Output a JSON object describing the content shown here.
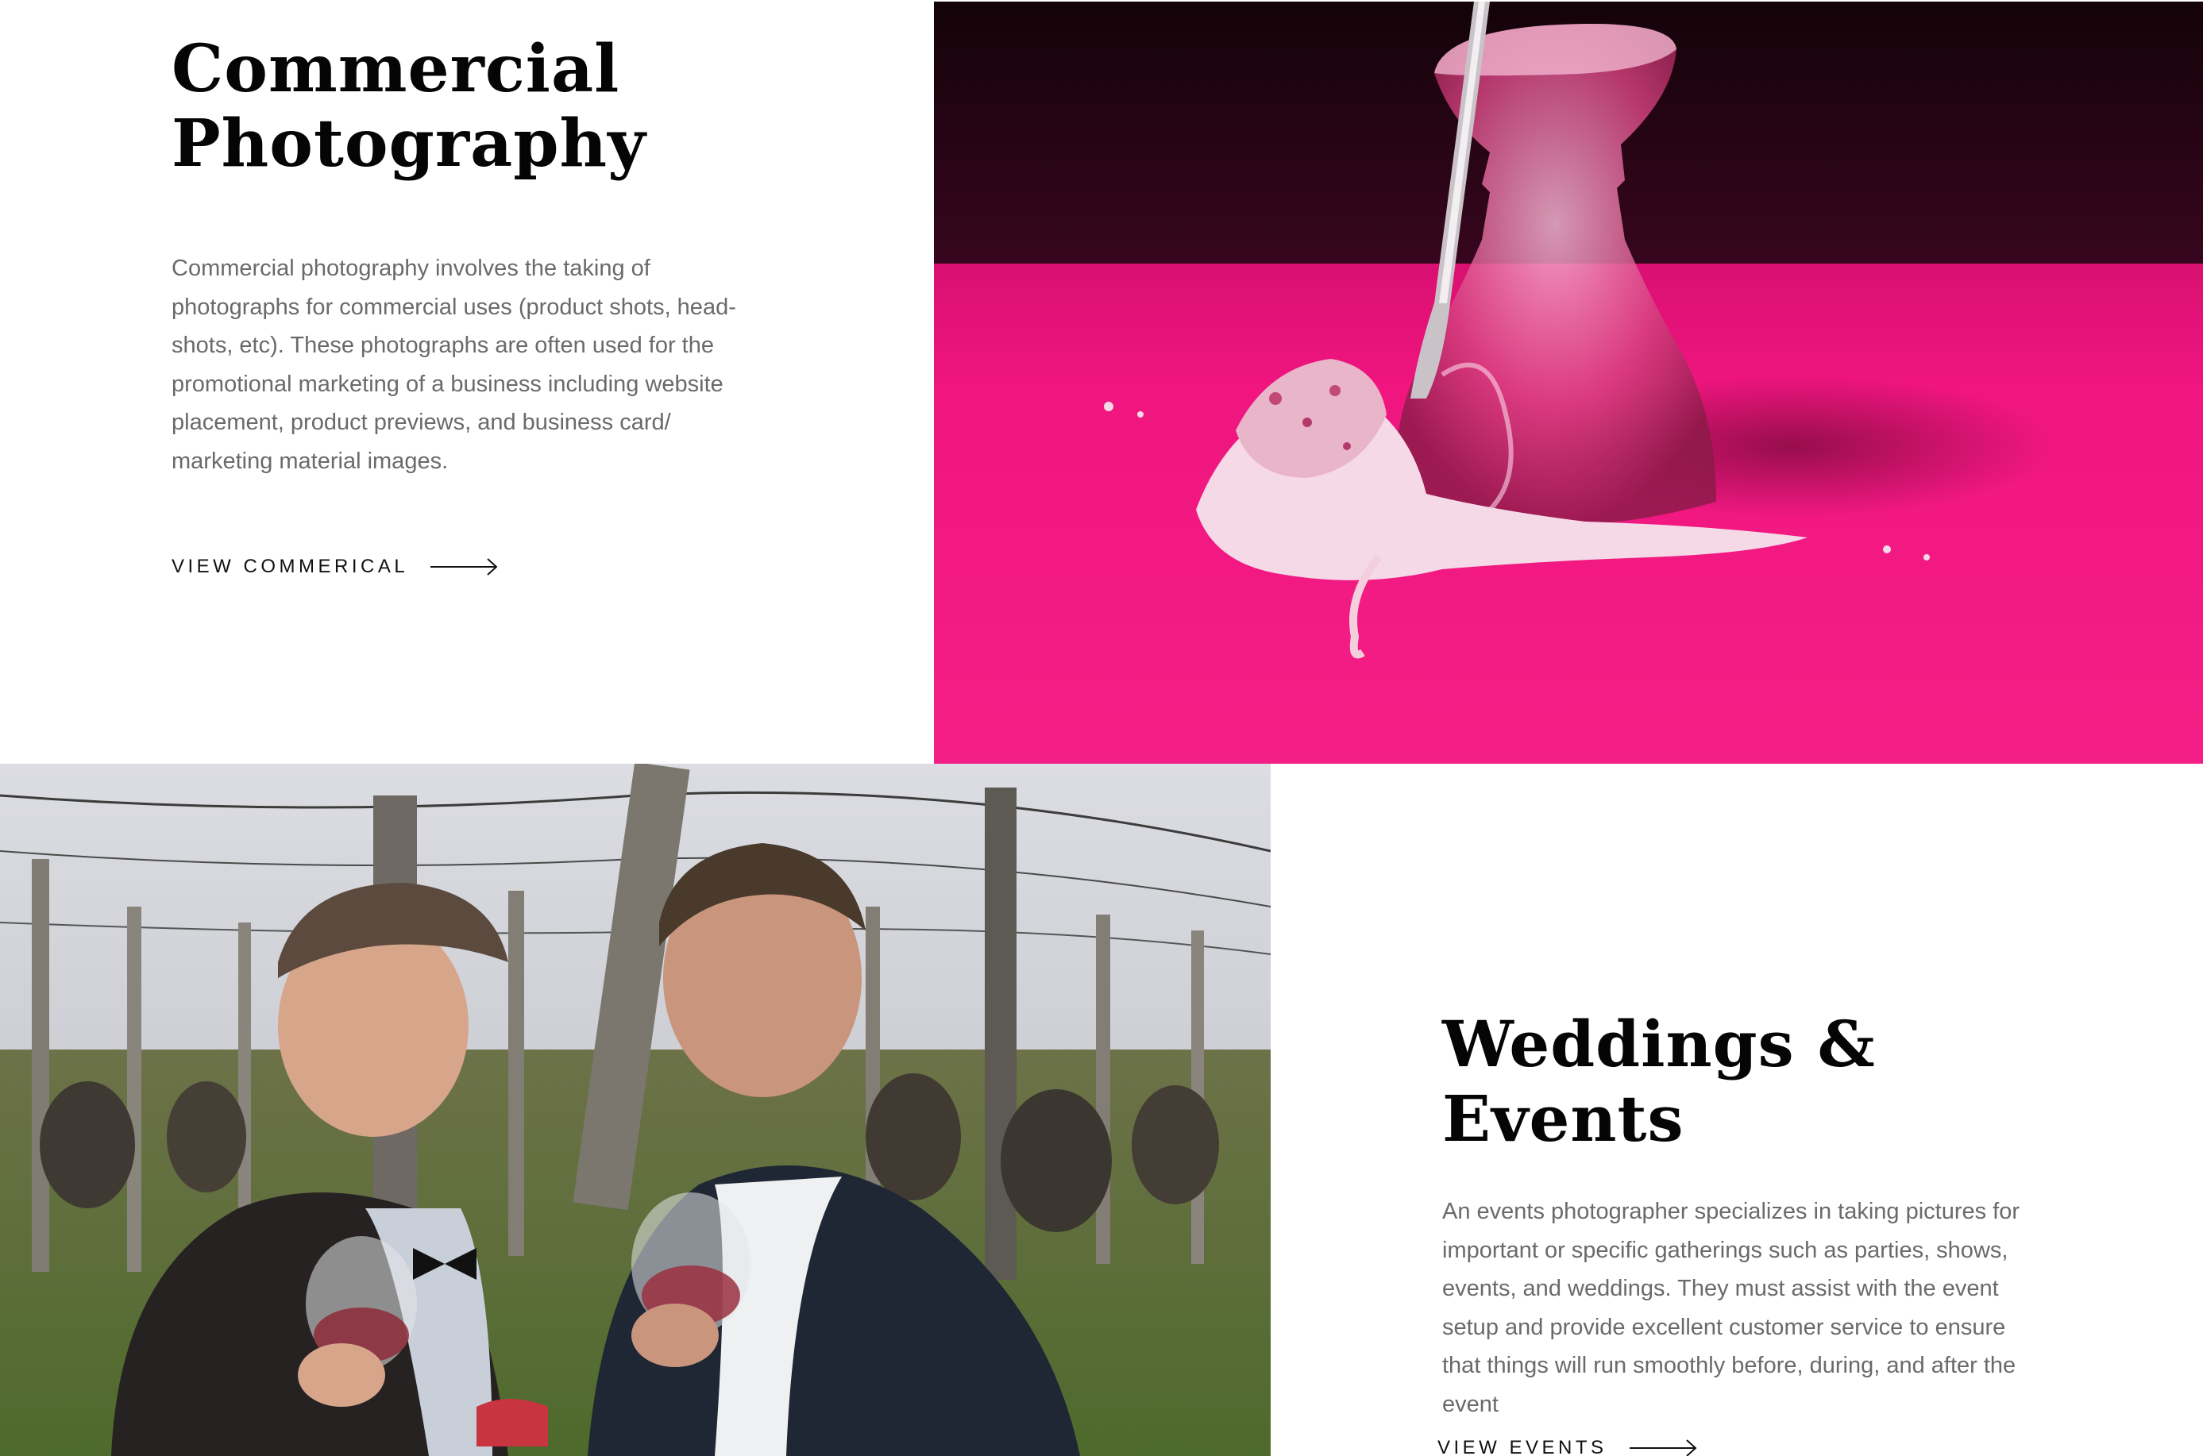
{
  "commercial": {
    "title_line1": "Commercial",
    "title_line2": "Photography",
    "description": "Commercial photography involves the taking of photographs for commercial uses (product shots, head-shots, etc). These photographs are often used for the promotional marketing of a business including website placement, product previews, and business card/ marketing material images.",
    "cta_label": "VIEW COMMERICAL",
    "cta_icon": "arrow-right-icon"
  },
  "events": {
    "title": "Weddings & Events",
    "description": "An events photographer specializes in taking pictures for important or specific gatherings such as parties, shows, events, and weddings. They must assist with the event setup and provide excellent customer service to ensure that things will run smoothly before, during, and after the event",
    "cta_label": "VIEW EVENTS",
    "cta_icon": "arrow-right-icon"
  },
  "colors": {
    "heading": "#050505",
    "body_text": "#6a6a6a",
    "accent_pink": "#f0157f",
    "background": "#ffffff"
  }
}
